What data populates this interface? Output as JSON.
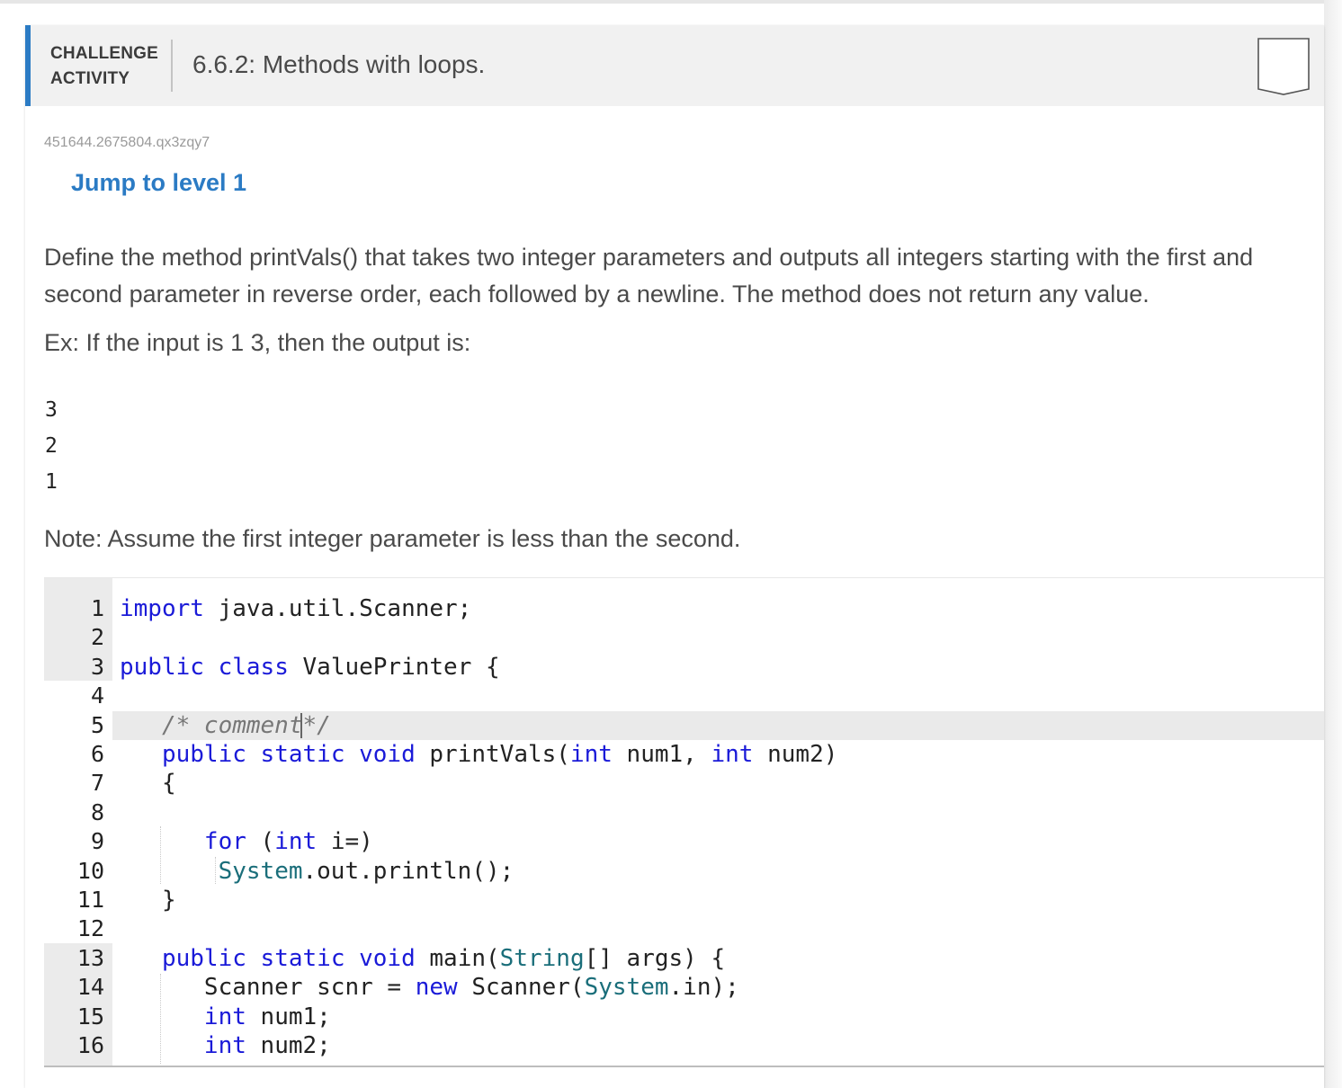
{
  "header": {
    "challenge_label_line1": "CHALLENGE",
    "challenge_label_line2": "ACTIVITY",
    "title": "6.6.2: Methods with loops."
  },
  "activity_id": "451644.2675804.qx3zqy7",
  "jump_link": "Jump to level 1",
  "description": "Define the method printVals() that takes two integer parameters and outputs all integers starting with the first and second parameter in reverse order, each followed by a newline. The method does not return any value.",
  "example_text": "Ex: If the input is 1 3, then the output is:",
  "example_output": [
    "3",
    "2",
    "1"
  ],
  "note": "Note: Assume the first integer parameter is less than the second.",
  "editor": {
    "line_numbers": [
      "1",
      "2",
      "3",
      "4",
      "5",
      "6",
      "7",
      "8",
      "9",
      "10",
      "11",
      "12",
      "13",
      "14",
      "15",
      "16"
    ],
    "lines": [
      [
        {
          "t": "import",
          "c": "kw"
        },
        {
          "t": " java.util.Scanner;",
          "c": ""
        }
      ],
      [],
      [
        {
          "t": "public",
          "c": "kw"
        },
        {
          "t": " ",
          "c": ""
        },
        {
          "t": "class",
          "c": "kw"
        },
        {
          "t": " ValuePrinter {",
          "c": ""
        }
      ],
      [],
      [
        {
          "t": "   /* comment*/",
          "c": "cm"
        }
      ],
      [
        {
          "t": "   ",
          "c": ""
        },
        {
          "t": "public",
          "c": "kw"
        },
        {
          "t": " ",
          "c": ""
        },
        {
          "t": "static",
          "c": "kw"
        },
        {
          "t": " ",
          "c": ""
        },
        {
          "t": "void",
          "c": "kw"
        },
        {
          "t": " printVals(",
          "c": ""
        },
        {
          "t": "int",
          "c": "kw"
        },
        {
          "t": " num1, ",
          "c": ""
        },
        {
          "t": "int",
          "c": "kw"
        },
        {
          "t": " num2)",
          "c": ""
        }
      ],
      [
        {
          "t": "   {",
          "c": ""
        }
      ],
      [],
      [
        {
          "t": "      ",
          "c": ""
        },
        {
          "t": "for",
          "c": "kw"
        },
        {
          "t": " (",
          "c": ""
        },
        {
          "t": "int",
          "c": "kw"
        },
        {
          "t": " i=)",
          "c": ""
        }
      ],
      [
        {
          "t": "       ",
          "c": ""
        },
        {
          "t": "System",
          "c": "cls"
        },
        {
          "t": ".out.println();",
          "c": ""
        }
      ],
      [
        {
          "t": "   }",
          "c": ""
        }
      ],
      [],
      [
        {
          "t": "   ",
          "c": ""
        },
        {
          "t": "public",
          "c": "kw"
        },
        {
          "t": " ",
          "c": ""
        },
        {
          "t": "static",
          "c": "kw"
        },
        {
          "t": " ",
          "c": ""
        },
        {
          "t": "void",
          "c": "kw"
        },
        {
          "t": " main(",
          "c": ""
        },
        {
          "t": "String",
          "c": "cls"
        },
        {
          "t": "[] args) {",
          "c": ""
        }
      ],
      [
        {
          "t": "      Scanner scnr = ",
          "c": ""
        },
        {
          "t": "new",
          "c": "kw"
        },
        {
          "t": " Scanner(",
          "c": ""
        },
        {
          "t": "System",
          "c": "cls"
        },
        {
          "t": ".in);",
          "c": ""
        }
      ],
      [
        {
          "t": "      ",
          "c": ""
        },
        {
          "t": "int",
          "c": "kw"
        },
        {
          "t": " num1;",
          "c": ""
        }
      ],
      [
        {
          "t": "      ",
          "c": ""
        },
        {
          "t": "int",
          "c": "kw"
        },
        {
          "t": " num2;",
          "c": ""
        }
      ]
    ]
  }
}
